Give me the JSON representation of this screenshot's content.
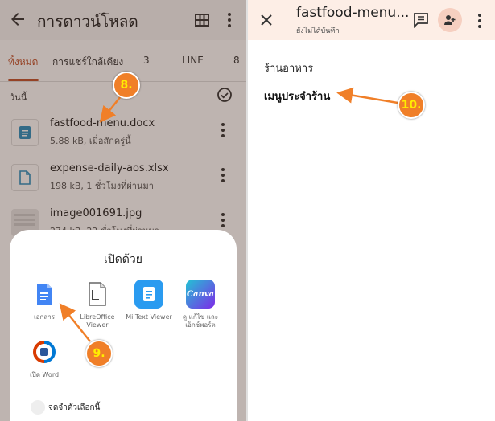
{
  "left": {
    "title": "การดาวน์โหลด",
    "tabs": [
      {
        "label": "ทั้งหมด"
      },
      {
        "label": "การแชร์ใกล้เคียง"
      },
      {
        "label": "3"
      },
      {
        "label": "LINE"
      },
      {
        "label": "8"
      }
    ],
    "section_label": "วันนี้",
    "files": [
      {
        "name": "fastfood-menu.docx",
        "meta": "5.88 kB, เมื่อสักครู่นี้",
        "icon": "docs-icon"
      },
      {
        "name": "expense-daily-aos.xlsx",
        "meta": "198 kB, 1 ชั่วโมงที่ผ่านมา",
        "icon": "file-icon"
      },
      {
        "name": "image001691.jpg",
        "meta": "274 kB, 22 ชั่วโมงที่ผ่านมา",
        "icon": "image-thumbnail"
      }
    ],
    "sheet": {
      "title": "เปิดด้วย",
      "apps": [
        {
          "label": "เอกสาร",
          "icon": "google-docs-icon"
        },
        {
          "label": "LibreOffice Viewer",
          "icon": "libreoffice-icon"
        },
        {
          "label": "Mi Text Viewer",
          "icon": "mi-text-viewer-icon"
        },
        {
          "label": "ดู แก้ไข และเอ็กซ์พอร์ต",
          "icon": "canva-icon"
        },
        {
          "label": "เปิด Word",
          "icon": "microsoft-office-icon"
        }
      ],
      "remember_label": "จดจำตัวเลือกนี้"
    }
  },
  "right": {
    "doc_title": "fastfood-menu...",
    "doc_subtitle": "ยังไม่ได้บันทึก",
    "body_line1": "ร้านอาหาร",
    "body_line2": "เมนูประจำร้าน"
  },
  "annotations": {
    "step8": "8.",
    "step9": "9.",
    "step10": "10."
  },
  "colors": {
    "accent": "#c0502a",
    "marker": "#f07f28",
    "marker_text": "#ffee00",
    "right_header": "#fdeee6"
  }
}
